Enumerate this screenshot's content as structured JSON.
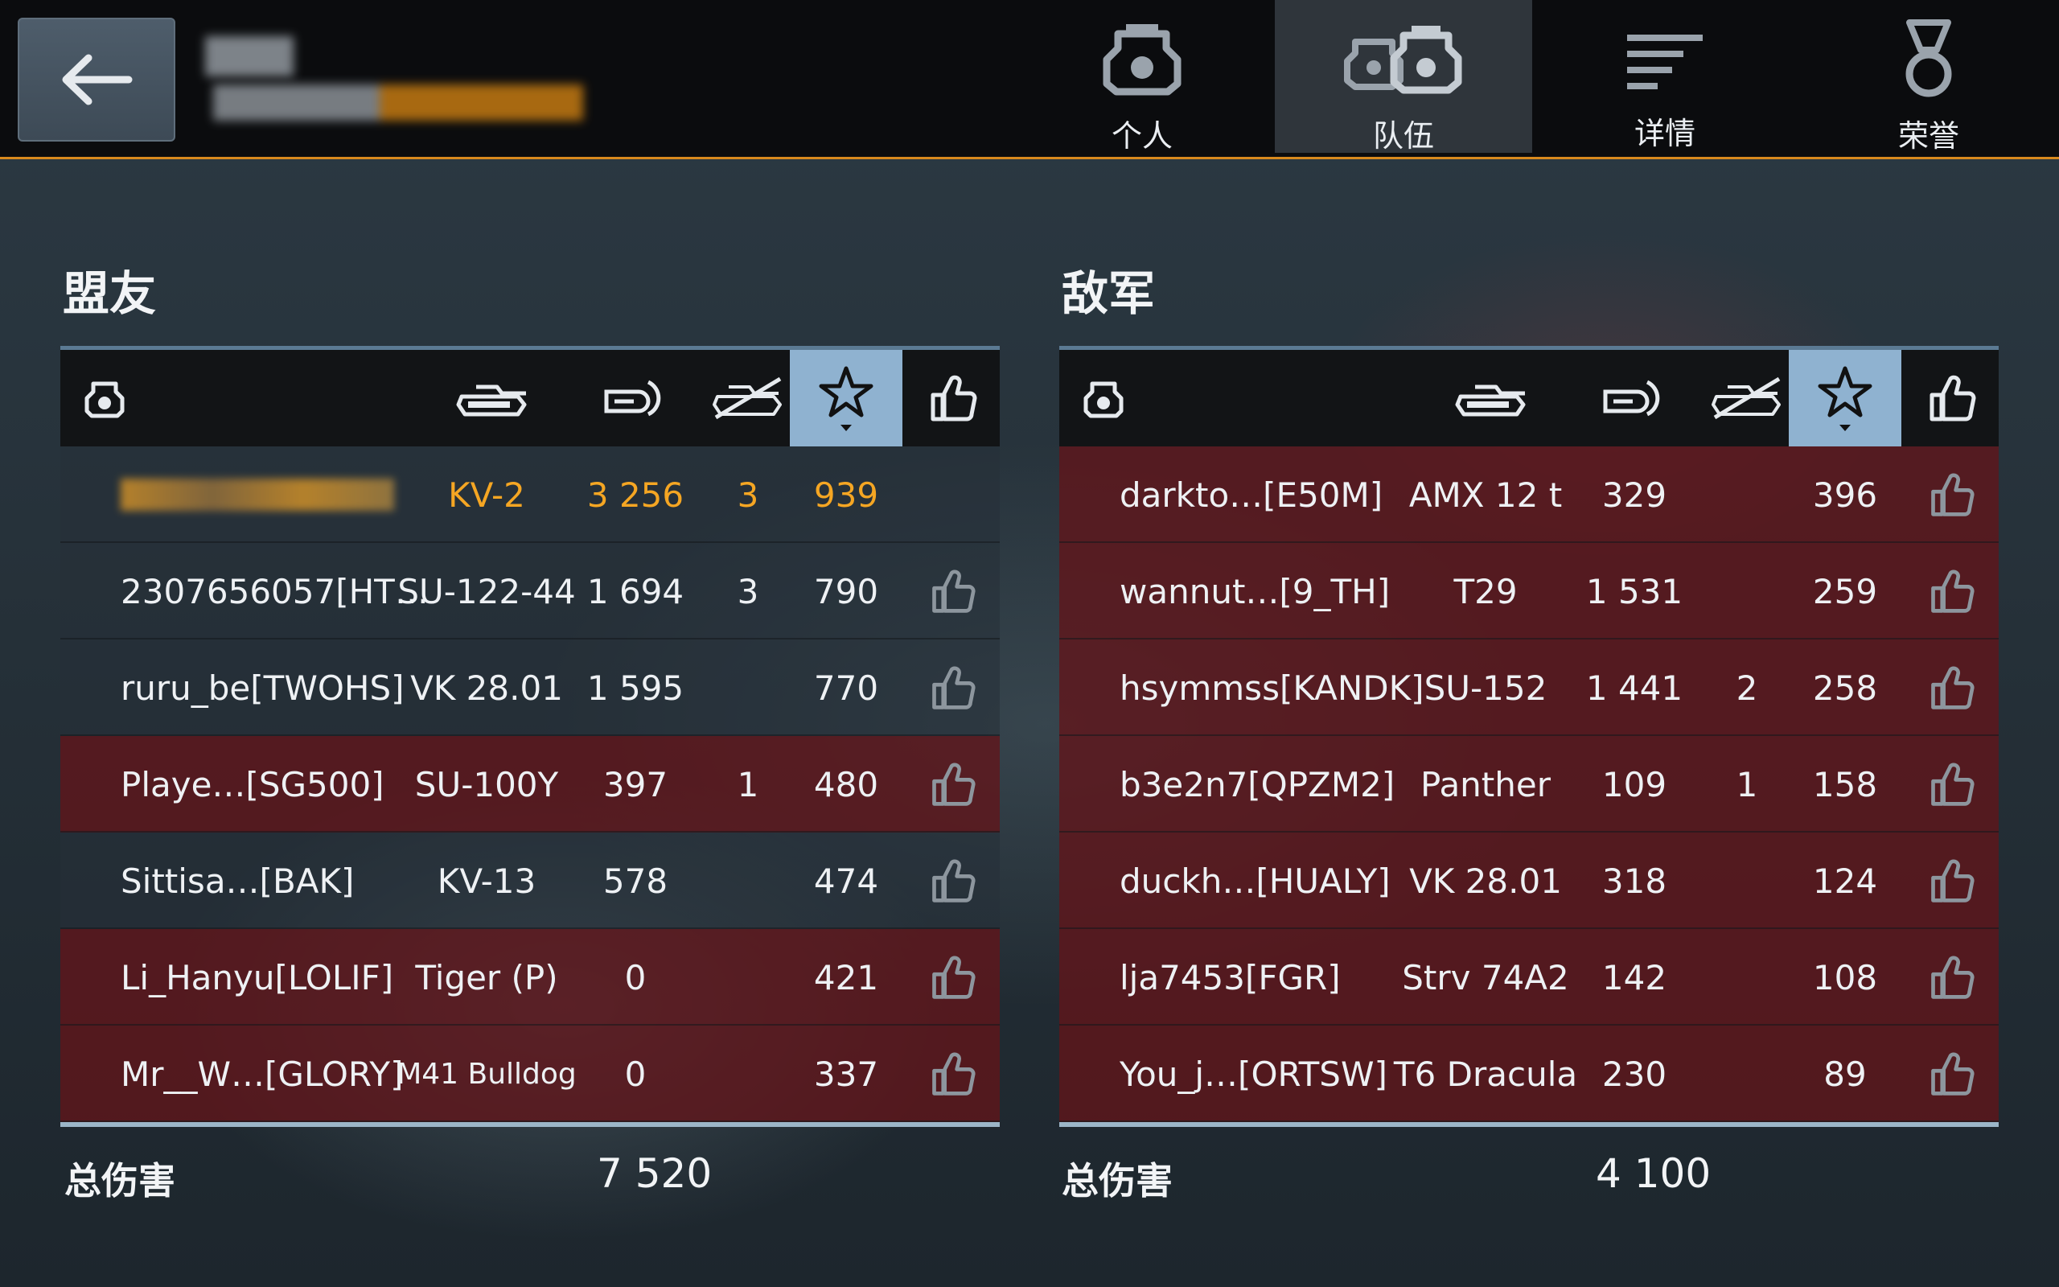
{
  "header": {
    "back_label": "",
    "tabs": [
      {
        "label": "个人",
        "icon": "personal-tank-icon",
        "active": false
      },
      {
        "label": "队伍",
        "icon": "team-icon",
        "active": true
      },
      {
        "label": "详情",
        "icon": "details-list-icon",
        "active": false
      },
      {
        "label": "荣誉",
        "icon": "medal-icon",
        "active": false
      }
    ]
  },
  "allies": {
    "title": "盟友",
    "total_label": "总伤害",
    "total_value": "7 520",
    "rows": [
      {
        "name": "",
        "tank": "KV-2",
        "damage": "3 256",
        "kills": "3",
        "score": "939",
        "self": true,
        "destroyed": false
      },
      {
        "name": "2307656057[HT…",
        "tank": "SU-122-44",
        "damage": "1 694",
        "kills": "3",
        "score": "790",
        "self": false,
        "destroyed": false
      },
      {
        "name": "ruru_be[TWOHS]",
        "tank": "VK 28.01",
        "damage": "1 595",
        "kills": "",
        "score": "770",
        "self": false,
        "destroyed": false
      },
      {
        "name": "Playe…[SG500]",
        "tank": "SU-100Y",
        "damage": "397",
        "kills": "1",
        "score": "480",
        "self": false,
        "destroyed": true
      },
      {
        "name": "Sittisa…[BAK]",
        "tank": "KV-13",
        "damage": "578",
        "kills": "",
        "score": "474",
        "self": false,
        "destroyed": false
      },
      {
        "name": "Li_Hanyu[LOLIF]",
        "tank": "Tiger (P)",
        "damage": "0",
        "kills": "",
        "score": "421",
        "self": false,
        "destroyed": true
      },
      {
        "name": "Mr__W…[GLORY]",
        "tank": "M41 Bulldog",
        "damage": "0",
        "kills": "",
        "score": "337",
        "self": false,
        "destroyed": true
      }
    ]
  },
  "enemies": {
    "title": "敌军",
    "total_label": "总伤害",
    "total_value": "4 100",
    "rows": [
      {
        "name": "darkto…[E50M]",
        "tank": "AMX 12 t",
        "damage": "329",
        "kills": "",
        "score": "396"
      },
      {
        "name": "wannut…[9_TH]",
        "tank": "T29",
        "damage": "1 531",
        "kills": "",
        "score": "259"
      },
      {
        "name": "hsymmss[KANDK]",
        "tank": "SU-152",
        "damage": "1 441",
        "kills": "2",
        "score": "258"
      },
      {
        "name": "b3e2n7[QPZM2]",
        "tank": "Panther",
        "damage": "109",
        "kills": "1",
        "score": "158"
      },
      {
        "name": "duckh…[HUALY]",
        "tank": "VK 28.01",
        "damage": "318",
        "kills": "",
        "score": "124"
      },
      {
        "name": "lja7453[FGR]",
        "tank": "Strv 74A2",
        "damage": "142",
        "kills": "",
        "score": "108"
      },
      {
        "name": "You_j…[ORTSW]",
        "tank": "T6 Dracula",
        "damage": "230",
        "kills": "",
        "score": "89"
      }
    ]
  },
  "columns": {
    "icons": [
      "player-helmet-icon",
      "tank-icon",
      "damage-shell-icon",
      "kills-crossed-icon",
      "score-star-icon",
      "like-thumb-icon"
    ]
  },
  "colors": {
    "accent": "#d98a1e",
    "self_text": "#f5a623",
    "sorted_header": "#8fb2d0",
    "enemy_row": "#62141a"
  }
}
